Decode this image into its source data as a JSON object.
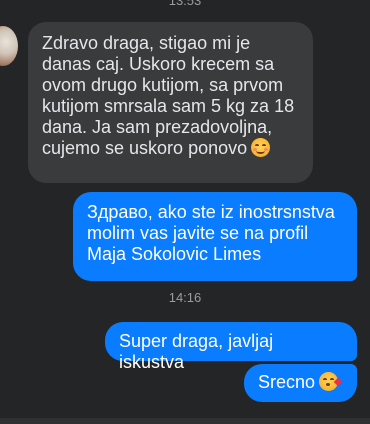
{
  "timestamps": {
    "top": "13:53",
    "middle": "14:16"
  },
  "messages": {
    "incoming_1": "Zdravo draga, stigao mi je\ndanas caj. Uskoro krecem sa\novom drugo kutijom, sa prvom\nkutijom smrsala sam 5 kg za 18\ndana. Ja sam prezadovoljna,\ncujemo se uskoro ponovo",
    "outgoing_1": "Здраво, ako ste iz inostrsnstva\nmolim vas javite se na profil\nMaja Sokolovic Limes",
    "outgoing_2": "Super draga, javljaj iskustva",
    "outgoing_3": "Srecno"
  },
  "icons": {
    "incoming_1_emoji": "smiling-face-with-smiling-eyes-emoji",
    "outgoing_3_emoji": "face-blowing-a-kiss-emoji"
  },
  "colors": {
    "background": "#242526",
    "incoming_bubble": "#3a3b3c",
    "outgoing_bubble": "#0a7cff"
  }
}
